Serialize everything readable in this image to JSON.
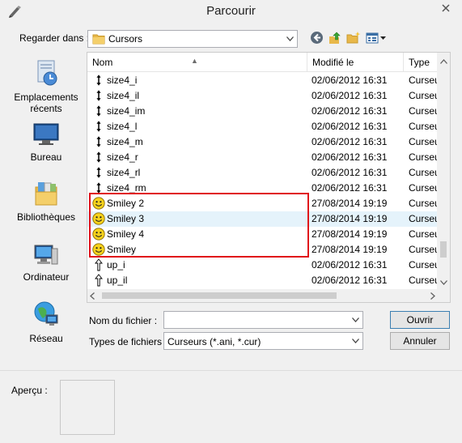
{
  "window": {
    "title": "Parcourir",
    "close_icon": "close-icon",
    "app_icon": "cursor-pen-icon"
  },
  "toolbar": {
    "look_in_label": "Regarder dans :",
    "look_in_value": "Cursors",
    "back_icon": "back-icon",
    "up_icon": "up-folder-icon",
    "new_folder_icon": "new-folder-icon",
    "view_icon": "view-menu-icon"
  },
  "places": [
    {
      "label": "Emplacements récents",
      "icon": "recent-places-icon"
    },
    {
      "label": "Bureau",
      "icon": "desktop-icon"
    },
    {
      "label": "Bibliothèques",
      "icon": "libraries-icon"
    },
    {
      "label": "Ordinateur",
      "icon": "computer-icon"
    },
    {
      "label": "Réseau",
      "icon": "network-icon"
    }
  ],
  "list": {
    "columns": {
      "name": "Nom",
      "date": "Modifié le",
      "type": "Type"
    },
    "rows": [
      {
        "name": "size4_i",
        "date": "02/06/2012 16:31",
        "type": "Curseur",
        "icon": "cursor-vertical-resize-icon"
      },
      {
        "name": "size4_il",
        "date": "02/06/2012 16:31",
        "type": "Curseur",
        "icon": "cursor-vertical-resize-icon"
      },
      {
        "name": "size4_im",
        "date": "02/06/2012 16:31",
        "type": "Curseur",
        "icon": "cursor-vertical-resize-icon"
      },
      {
        "name": "size4_l",
        "date": "02/06/2012 16:31",
        "type": "Curseur",
        "icon": "cursor-vertical-resize-icon"
      },
      {
        "name": "size4_m",
        "date": "02/06/2012 16:31",
        "type": "Curseur",
        "icon": "cursor-vertical-resize-icon"
      },
      {
        "name": "size4_r",
        "date": "02/06/2012 16:31",
        "type": "Curseur",
        "icon": "cursor-vertical-resize-icon"
      },
      {
        "name": "size4_rl",
        "date": "02/06/2012 16:31",
        "type": "Curseur",
        "icon": "cursor-vertical-resize-icon"
      },
      {
        "name": "size4_rm",
        "date": "02/06/2012 16:31",
        "type": "Curseur",
        "icon": "cursor-vertical-resize-icon"
      },
      {
        "name": "Smiley 2",
        "date": "27/08/2014 19:19",
        "type": "Curseur",
        "icon": "smiley-icon"
      },
      {
        "name": "Smiley 3",
        "date": "27/08/2014 19:19",
        "type": "Curseur",
        "icon": "smiley-icon",
        "selected": true
      },
      {
        "name": "Smiley 4",
        "date": "27/08/2014 19:19",
        "type": "Curseur",
        "icon": "smiley-icon"
      },
      {
        "name": "Smiley",
        "date": "27/08/2014 19:19",
        "type": "Curseur",
        "icon": "smiley-icon"
      },
      {
        "name": "up_i",
        "date": "02/06/2012 16:31",
        "type": "Curseur",
        "icon": "cursor-up-arrow-icon"
      },
      {
        "name": "up_il",
        "date": "02/06/2012 16:31",
        "type": "Curseur",
        "icon": "cursor-up-arrow-icon"
      }
    ]
  },
  "form": {
    "filename_label": "Nom du fichier :",
    "filename_value": "",
    "filetype_label": "Types de fichiers :",
    "filetype_value": "Curseurs (*.ani, *.cur)",
    "open_button": "Ouvrir",
    "cancel_button": "Annuler"
  },
  "preview": {
    "label": "Aperçu :"
  },
  "annotation": {
    "highlight_color": "#e0101a"
  }
}
